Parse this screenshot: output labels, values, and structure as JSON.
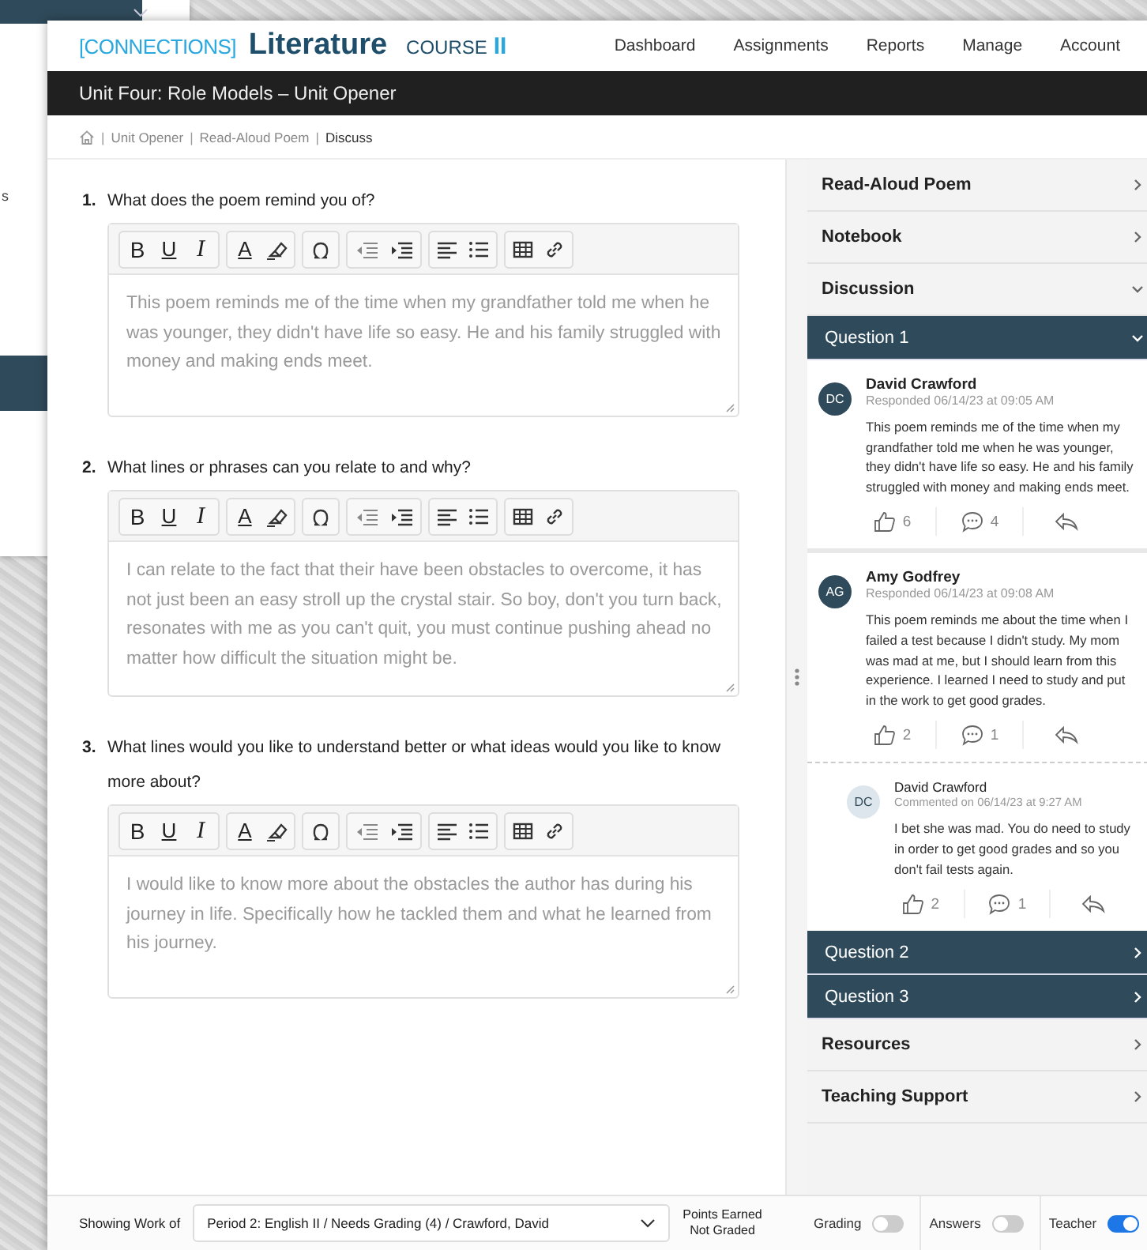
{
  "background_window": {
    "text": "s"
  },
  "header": {
    "logo": {
      "brand": "[CONNECTIONS]",
      "product": "Literature",
      "course": "COURSE",
      "level": "II"
    },
    "nav": [
      "Dashboard",
      "Assignments",
      "Reports",
      "Manage",
      "Account"
    ]
  },
  "title_bar": "Unit Four: Role Models – Unit Opener",
  "breadcrumb": [
    {
      "separator": "|",
      "label": "Unit Opener",
      "current": false
    },
    {
      "separator": "|",
      "label": "Read-Aloud Poem",
      "current": false
    },
    {
      "separator": "|",
      "label": "Discuss",
      "current": true
    }
  ],
  "questions": [
    {
      "number": "1.",
      "prompt": "What does the poem remind you of?",
      "format_labels": [
        "B",
        "U",
        "I",
        "A"
      ],
      "answer": "This poem reminds me of the time when my grandfather told me when he was younger, they didn't have life so easy. He and his family struggled with money and making ends meet."
    },
    {
      "number": "2.",
      "prompt": "What lines or phrases can you relate to and why?",
      "format_labels": [
        "B",
        "U",
        "I",
        "A"
      ],
      "answer": "I can relate to the fact that their have been obstacles to overcome, it has not just been an easy stroll up the crystal stair.  So boy, don't you turn back, resonates with me as you can't quit, you must continue pushing ahead no matter how difficult the situation might be."
    },
    {
      "number": "3.",
      "prompt": "What lines would you like to understand better or what ideas would you like to know more about?",
      "format_labels": [
        "B",
        "U",
        "I",
        "A"
      ],
      "answer": "I would like to know more about the obstacles the author has during his journey in life. Specifically how he tackled them and what he learned from his journey."
    }
  ],
  "sidebar": [
    {
      "kind": "section",
      "label": "Read-Aloud Poem",
      "expanded": false
    },
    {
      "kind": "section",
      "label": "Notebook",
      "expanded": false
    },
    {
      "kind": "section",
      "label": "Discussion",
      "expanded": true
    },
    {
      "kind": "question",
      "label": "Question 1",
      "expanded": true,
      "comments": [
        {
          "initials": "DC",
          "name": "David Crawford",
          "meta": "Responded 06/14/23 at 09:05 AM",
          "body": "This poem reminds me of the time when my grandfather told me when he was younger, they didn't have life so easy. He and his family struggled with money and making ends meet.",
          "likes": "6",
          "replies": "4"
        },
        {
          "initials": "AG",
          "name": "Amy Godfrey",
          "meta": "Responded 06/14/23 at 09:08 AM",
          "body": "This poem reminds me about the time when I failed a test because I didn't study. My mom was mad at me, but I should learn from this experience. I learned I need to study and put in the work to get good grades.",
          "likes": "2",
          "replies": "1",
          "children": [
            {
              "initials": "DC",
              "name": "David Crawford",
              "meta": "Commented on 06/14/23 at 9:27 AM",
              "body": "I bet she was mad. You do need to study in order to get good grades and so you don't fail tests again.",
              "likes": "2",
              "replies": "1"
            }
          ]
        }
      ]
    },
    {
      "kind": "question",
      "label": "Question 2",
      "expanded": false
    },
    {
      "kind": "question",
      "label": "Question 3",
      "expanded": false
    },
    {
      "kind": "section",
      "label": "Resources",
      "expanded": false
    },
    {
      "kind": "section",
      "label": "Teaching Support",
      "expanded": false
    }
  ],
  "footer": {
    "showing_label": "Showing Work of",
    "student_select": "Period 2: English II / Needs Grading (4) / Crawford, David",
    "points_label": "Points Earned",
    "points_value": "Not Graded",
    "toggles": [
      {
        "label": "Grading",
        "on": false
      },
      {
        "label": "Answers",
        "on": false
      },
      {
        "label": "Teacher",
        "on": true
      }
    ]
  }
}
